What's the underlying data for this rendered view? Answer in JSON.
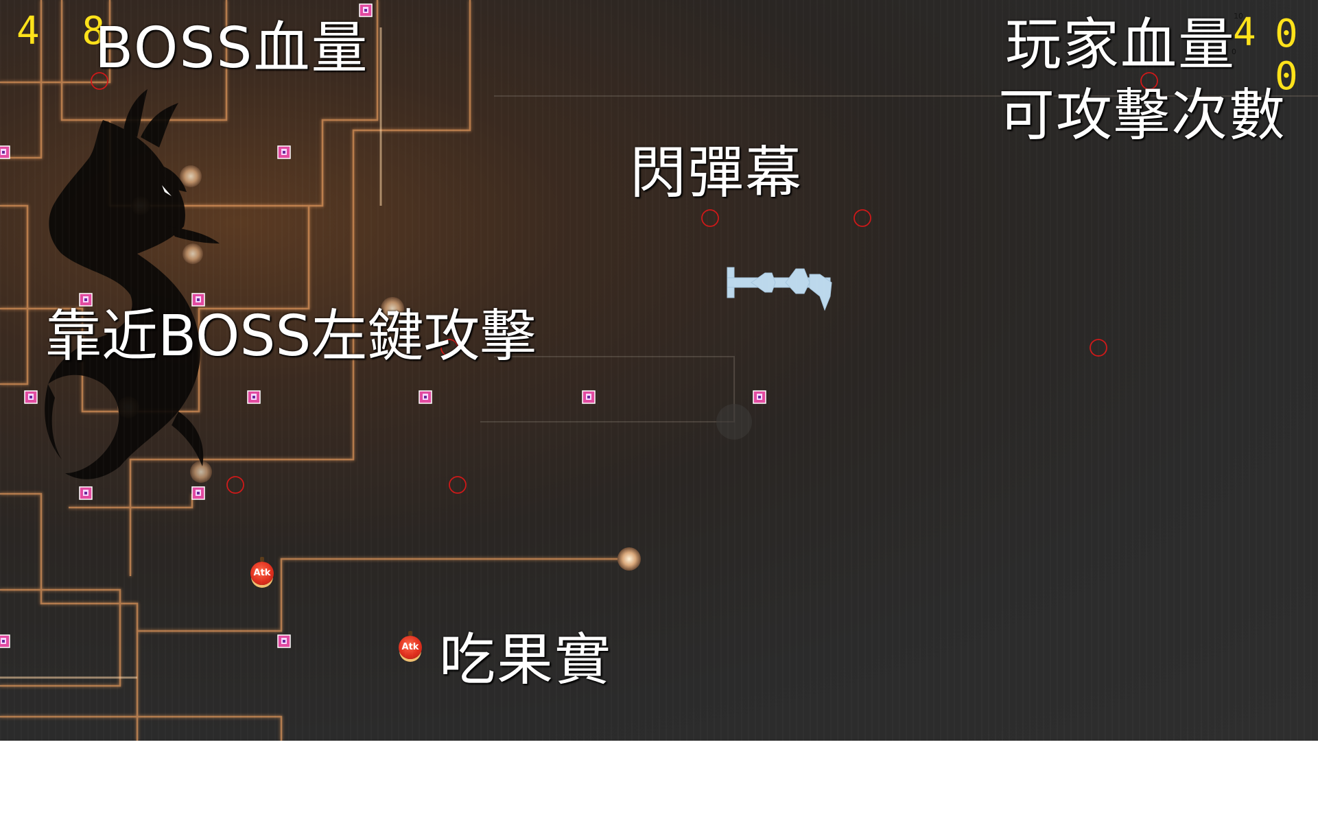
{
  "hud": {
    "boss_hp_value": "4 8",
    "boss_hp_label": "BOSS血量",
    "player_hp_label": "玩家血量",
    "player_hp_value": "4",
    "attack_count_label": "可攻擊次數",
    "attack_count_value_1": "0",
    "attack_count_value_2": "0",
    "small_marks": [
      "10",
      "0"
    ]
  },
  "hints": {
    "dodge": "閃彈幕",
    "attack": "靠近BOSS左鍵攻擊",
    "eat": "吃果實"
  },
  "fruit": {
    "label": "Atk"
  },
  "colors": {
    "label": "#ffffff",
    "numbers": "#ffe21a",
    "bullet_ring": "#d01818",
    "player_ship": "#bcd8ec",
    "circuit_glow": "#f2b070"
  },
  "icons": [
    "dragon-boss-icon",
    "player-ship-icon",
    "pixel-bullet-icon",
    "ring-bullet-icon",
    "atk-fruit-icon"
  ]
}
